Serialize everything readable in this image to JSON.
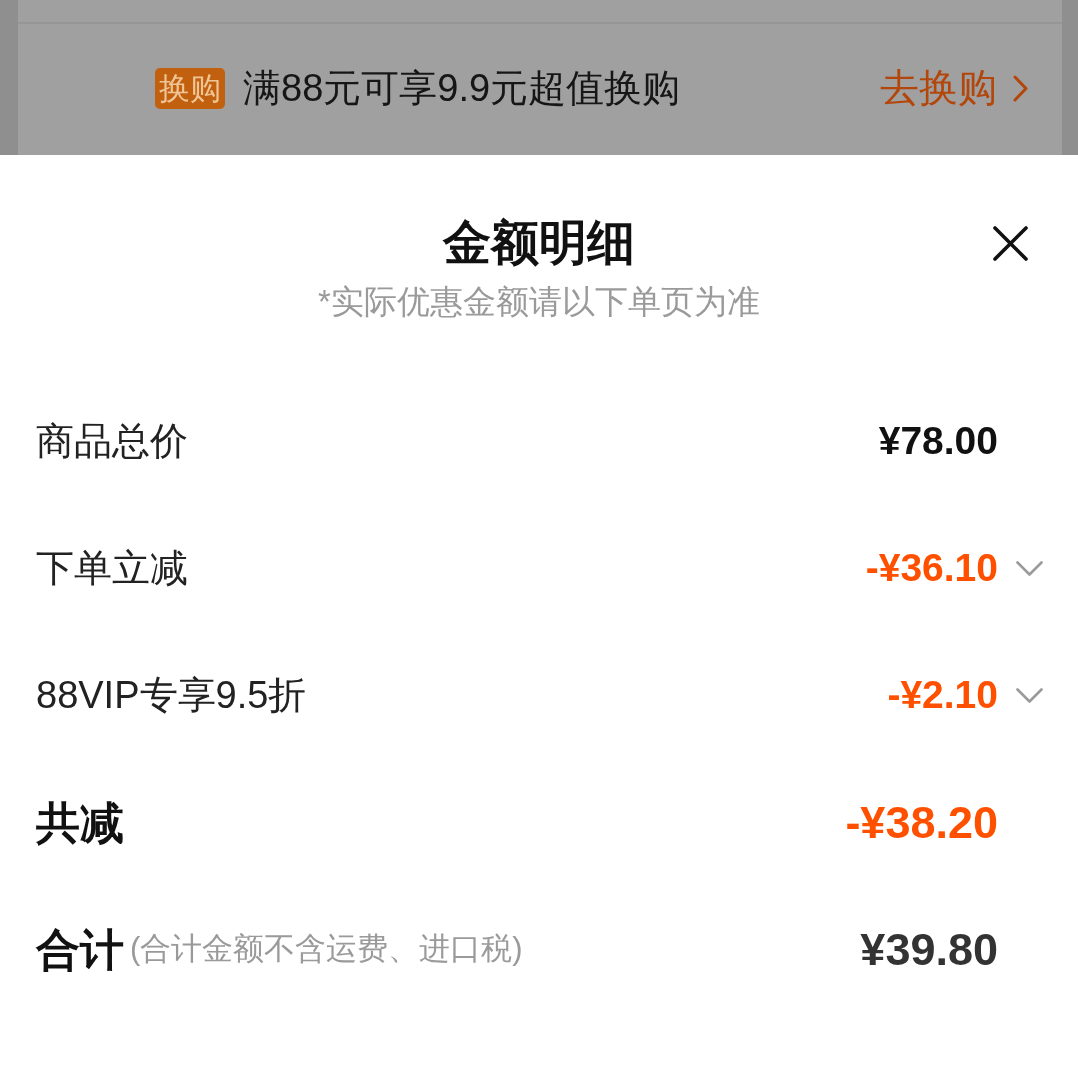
{
  "background_page": {
    "promo": {
      "badge": "换购",
      "text": "满88元可享9.9元超值换购",
      "link": "去换购"
    }
  },
  "sheet": {
    "title": "金额明细",
    "subtitle": "*实际优惠金额请以下单页为准",
    "rows": [
      {
        "kind": "plain",
        "label": "商品总价",
        "value": "¥78.00"
      },
      {
        "kind": "discount",
        "label": "下单立减",
        "value": "-¥36.10",
        "expanded": false
      },
      {
        "kind": "discount",
        "label": "88VIP专享9.5折",
        "value": "-¥2.10",
        "expanded": false
      },
      {
        "kind": "total",
        "label": "共减",
        "value": "-¥38.20"
      },
      {
        "kind": "sum",
        "label": "合计",
        "note": "(合计金额不含运费、进口税)",
        "value": "¥39.80"
      }
    ]
  }
}
